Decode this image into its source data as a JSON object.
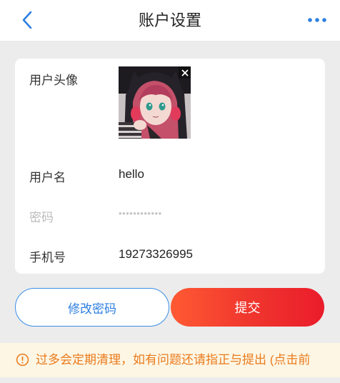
{
  "header": {
    "title": "账户设置",
    "back_icon": "chevron-left-icon",
    "more_icon": "more-dots-icon",
    "accent_color": "#2d7fe0"
  },
  "form": {
    "avatar_label": "用户头像",
    "avatar_image": "anime-girl-avatar",
    "username_label": "用户名",
    "username_value": "hello",
    "password_label": "密码",
    "password_value": "••••••••••••",
    "phone_label": "手机号",
    "phone_value": "19273326995"
  },
  "actions": {
    "change_password_label": "修改密码",
    "submit_label": "提交",
    "submit_gradient": [
      "#ff5a33",
      "#ea1c2b"
    ]
  },
  "notice": {
    "icon": "info-circle-icon",
    "text": "过多会定期清理，如有问题还请指正与提出 (点击前",
    "color": "#ea7a1c",
    "background": "#fdf6e4"
  }
}
